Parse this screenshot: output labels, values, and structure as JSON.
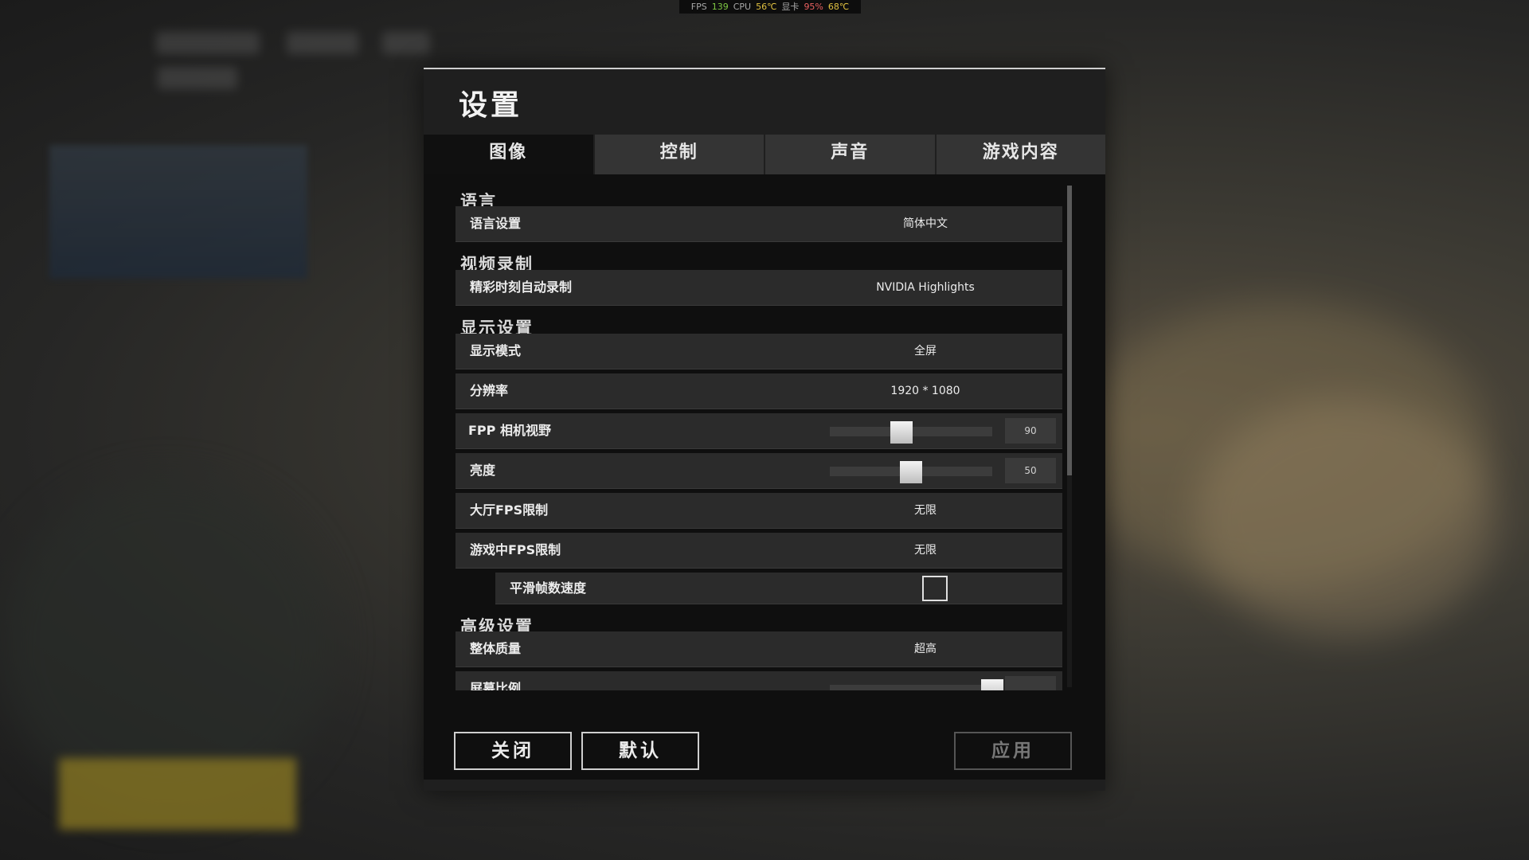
{
  "perf_overlay": {
    "fps_label": "FPS",
    "fps_value": "139",
    "cpu_label": "CPU",
    "cpu_temp": "56℃",
    "gpu_label": "显卡",
    "gpu_usage": "95%",
    "gpu_temp": "68℃"
  },
  "settings": {
    "title": "设置",
    "tabs": [
      {
        "label": "图像",
        "active": true
      },
      {
        "label": "控制",
        "active": false
      },
      {
        "label": "声音",
        "active": false
      },
      {
        "label": "游戏内容",
        "active": false
      }
    ],
    "sections": {
      "language": "语言",
      "video_recording": "视频录制",
      "display": "显示设置",
      "advanced": "高级设置"
    },
    "rows": {
      "language_setting": {
        "label": "语言设置",
        "value": "简体中文"
      },
      "highlights": {
        "label": "精彩时刻自动录制",
        "value": "NVIDIA Highlights"
      },
      "display_mode": {
        "label": "显示模式",
        "value": "全屏"
      },
      "resolution": {
        "label": "分辨率",
        "value": "1920 * 1080"
      },
      "fpp_fov": {
        "label": "FPP 相机视野",
        "value": "90",
        "fraction": 0.44
      },
      "brightness": {
        "label": "亮度",
        "value": "50",
        "fraction": 0.5
      },
      "lobby_fps": {
        "label": "大厅FPS限制",
        "value": "无限"
      },
      "ingame_fps": {
        "label": "游戏中FPS限制",
        "value": "无限"
      },
      "smooth_fps": {
        "label": "平滑帧数速度",
        "checked": false
      },
      "overall_quality": {
        "label": "整体质量",
        "value": "超高"
      },
      "screen_scale": {
        "label": "屏幕比例"
      }
    },
    "buttons": {
      "close": "关闭",
      "default": "默认",
      "apply": "应用"
    }
  }
}
